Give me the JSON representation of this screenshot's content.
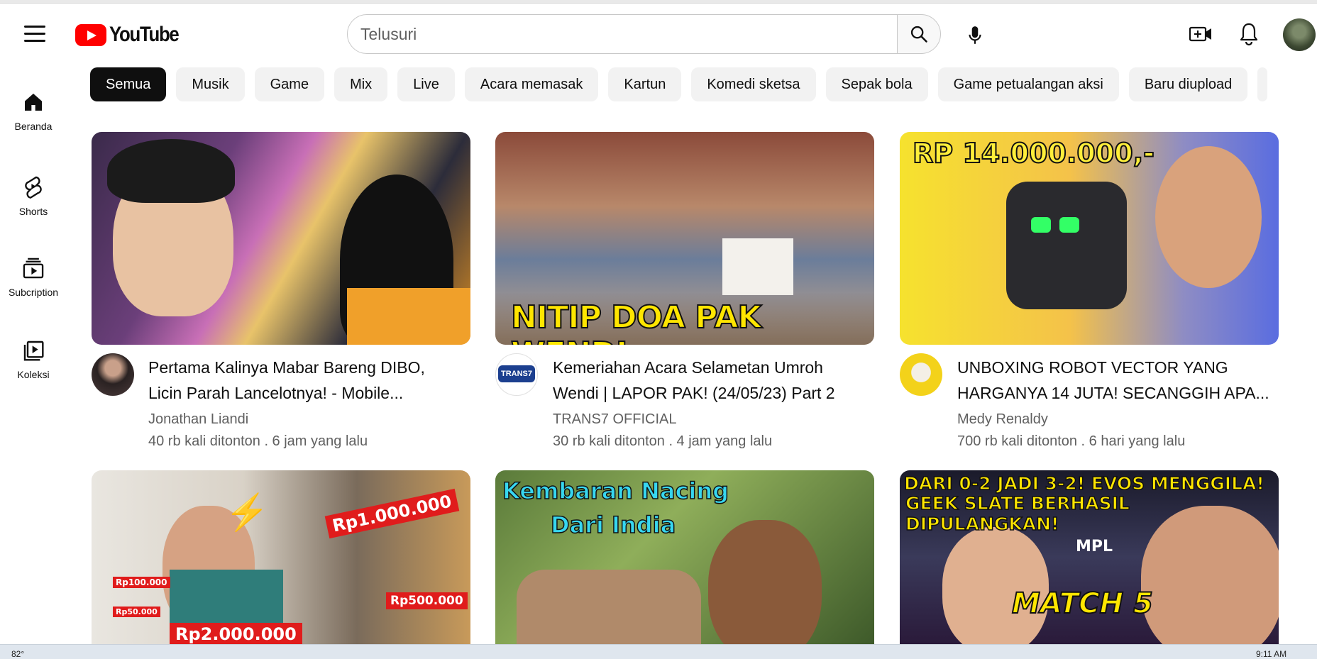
{
  "header": {
    "logo_text": "YouTube",
    "search_placeholder": "Telusuri"
  },
  "sidebar": {
    "items": [
      {
        "label": "Beranda",
        "icon": "home-icon"
      },
      {
        "label": "Shorts",
        "icon": "shorts-icon"
      },
      {
        "label": "Subcription",
        "icon": "subscriptions-icon"
      },
      {
        "label": "Koleksi",
        "icon": "library-icon"
      }
    ]
  },
  "chips": [
    "Semua",
    "Musik",
    "Game",
    "Mix",
    "Live",
    "Acara memasak",
    "Kartun",
    "Komedi sketsa",
    "Sepak bola",
    "Game petualangan aksi",
    "Baru diupload"
  ],
  "videos": [
    {
      "title": "Pertama Kalinya Mabar Bareng DIBO, Licin Parah Lancelotnya! - Mobile...",
      "channel": "Jonathan Liandi",
      "meta": "40 rb kali ditonton . 6 jam yang lalu"
    },
    {
      "title": "Kemeriahan Acara Selametan Umroh Wendi | LAPOR PAK! (24/05/23) Part 2",
      "channel": "TRANS7 OFFICIAL",
      "meta": "30 rb kali ditonton . 4 jam yang lalu",
      "thumb_caption": "NITIP DOA PAK WENDI",
      "avatar_text": "TRANS7"
    },
    {
      "title": "UNBOXING ROBOT VECTOR YANG HARGANYA 14 JUTA! SECANGGIH APA...",
      "channel": "Medy Renaldy",
      "meta": "700 rb kali ditonton . 6 hari yang lalu",
      "thumb_caption": "RP 14.000.000,-"
    }
  ],
  "row2_thumbs": [
    {
      "captions": [
        "Rp1.000.000",
        "Rp100.000",
        "Rp50.000",
        "Rp500.000",
        "Rp2.000.000"
      ]
    },
    {
      "captions": [
        "Kembaran Nacing",
        "Dari India"
      ]
    },
    {
      "captions": [
        "DARI 0-2 JADI 3-2! EVOS MENGGILA!",
        "GEEK SLATE BERHASIL DIPULANGKAN!",
        "MATCH 5",
        "MPL"
      ]
    }
  ],
  "taskbar": {
    "temp": "82°",
    "time": "9:11 AM"
  },
  "colors": {
    "brand_red": "#ff0000",
    "chip_active": "#0f0f0f",
    "chip_bg": "#f2f2f2",
    "meta_gray": "#606060"
  }
}
